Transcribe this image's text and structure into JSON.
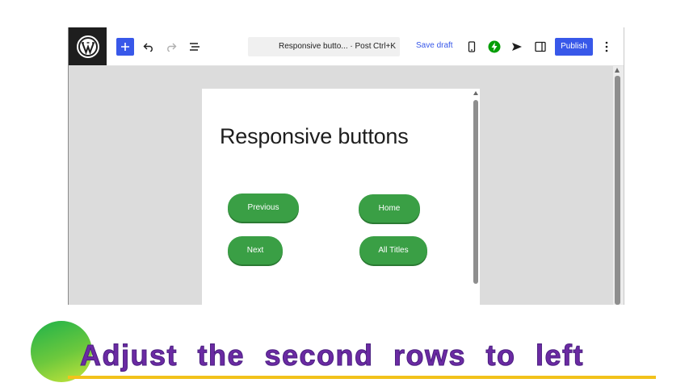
{
  "editor": {
    "command_bar": {
      "title": "Responsive butto... · Post",
      "shortcut": "Ctrl+K"
    },
    "save_draft_label": "Save draft",
    "publish_label": "Publish",
    "accent_color": "#3858e9",
    "icons": [
      "wordpress-logo-icon",
      "plus-icon",
      "undo-icon",
      "redo-icon",
      "list-view-icon",
      "mobile-preview-icon",
      "jetpack-bolt-icon",
      "send-icon",
      "sidebar-toggle-icon",
      "more-options-icon"
    ]
  },
  "canvas": {
    "page_title": "Responsive buttons",
    "buttons": [
      {
        "label": "Previous"
      },
      {
        "label": "Home"
      },
      {
        "label": "Next"
      },
      {
        "label": "All Titles"
      }
    ],
    "button_color": "#3a9f45"
  },
  "caption": {
    "text": "Adjust the second rows to left",
    "text_color": "#6b2aa3",
    "underline_color": "#f2c21b"
  }
}
